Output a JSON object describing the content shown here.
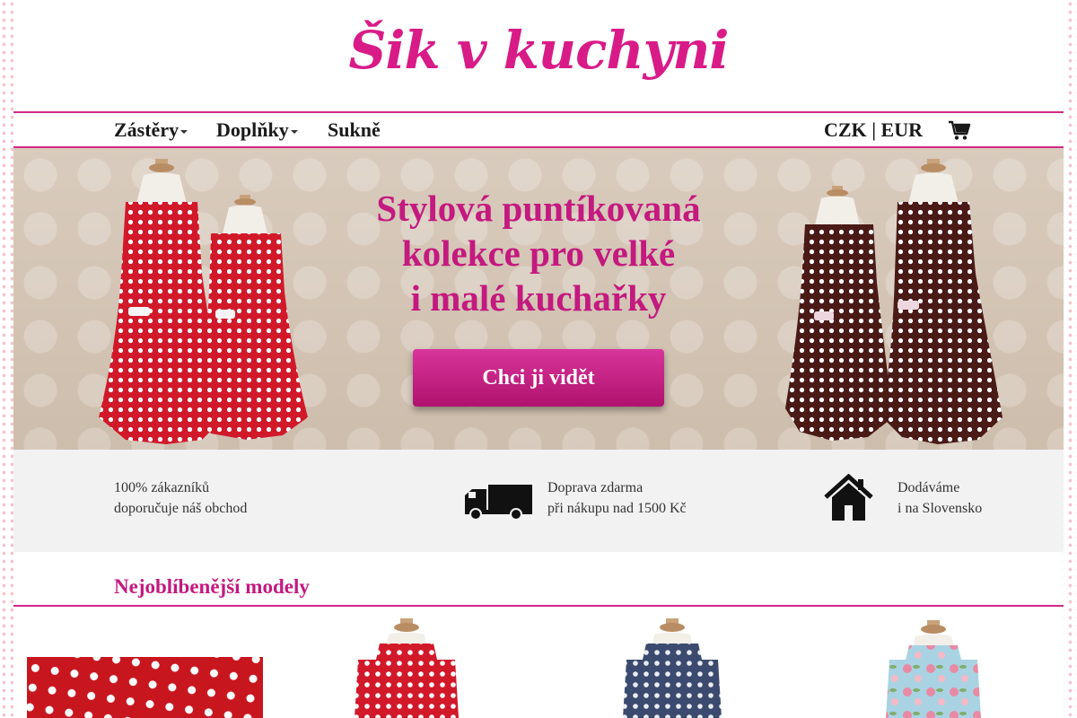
{
  "header": {
    "logo_text": "Šik v kuchyni"
  },
  "nav": {
    "items": [
      {
        "label": "Zástěry",
        "has_dropdown": true
      },
      {
        "label": "Doplňky",
        "has_dropdown": true
      },
      {
        "label": "Sukně",
        "has_dropdown": false
      }
    ],
    "currency": {
      "czk": "CZK",
      "separator": " | ",
      "eur": "EUR"
    },
    "cart_icon": "shopping-cart-icon"
  },
  "hero": {
    "title_lines": [
      "Stylová puntíkovaná",
      "kolekce pro velké",
      "i malé kuchařky"
    ],
    "cta_label": "Chci ji vidět"
  },
  "benefits": [
    {
      "line1": "100% zákazníků",
      "line2": "doporučuje náš obchod",
      "icon": null
    },
    {
      "line1": "Doprava zdarma",
      "line2": "při nákupu nad 1500 Kč",
      "icon": "truck-icon"
    },
    {
      "line1": "Dodáváme",
      "line2": "i na Slovensko",
      "icon": "house-icon"
    }
  ],
  "popular": {
    "title": "Nejoblíbenější modely"
  },
  "colors": {
    "brand_pink": "#c4197f",
    "accent_line": "#d02a86",
    "benefits_bg": "#f2f2f2",
    "apron_red": "#d1192a",
    "apron_brown": "#4a1a16",
    "apron_navy": "#3b4a6e",
    "apron_floral": "#a9d3e3"
  }
}
